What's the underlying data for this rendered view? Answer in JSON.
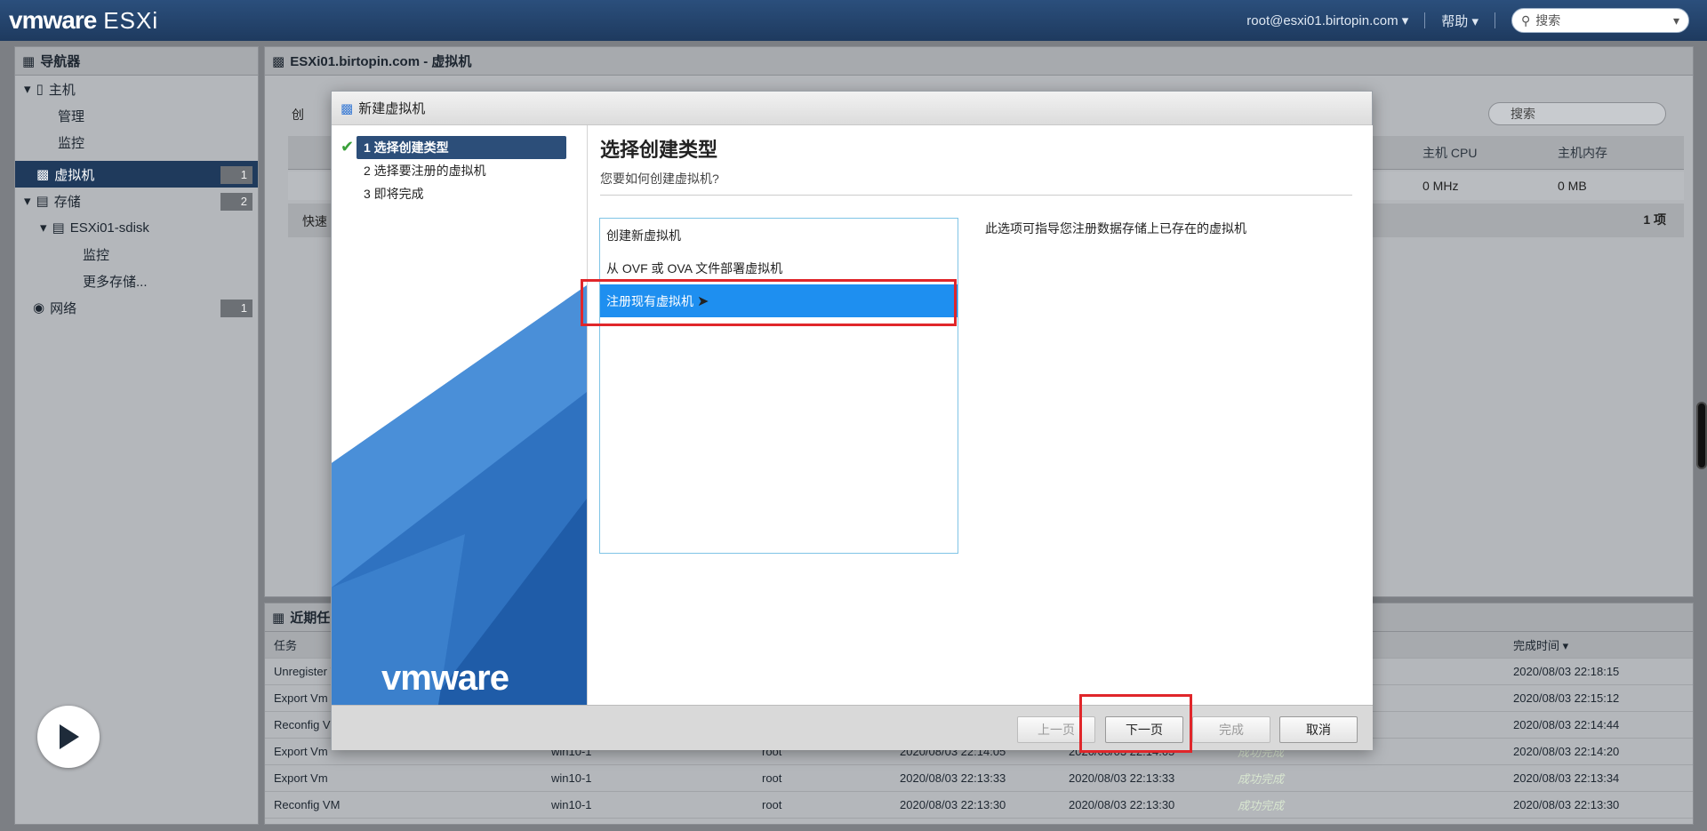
{
  "top": {
    "brand_vm": "vmware",
    "brand_esxi": "ESXi",
    "user": "root@esxi01.birtopin.com",
    "help": "帮助",
    "search_placeholder": "搜索"
  },
  "navigator": {
    "title": "导航器",
    "items": [
      {
        "label": "主机",
        "badge": ""
      },
      {
        "label": "管理",
        "badge": ""
      },
      {
        "label": "监控",
        "badge": ""
      },
      {
        "label": "虚拟机",
        "badge": "1"
      },
      {
        "label": "存储",
        "badge": "2"
      },
      {
        "label": "ESXi01-sdisk",
        "badge": ""
      },
      {
        "label": "监控",
        "badge": ""
      },
      {
        "label": "更多存储...",
        "badge": ""
      },
      {
        "label": "网络",
        "badge": "1"
      }
    ]
  },
  "vmpanel": {
    "title": "ESXi01.birtopin.com - 虚拟机",
    "create_abbr": "创",
    "quick_abbr": "快速",
    "search_placeholder": "搜索",
    "col_cpu": "主机 CPU",
    "col_mem": "主机内存",
    "row_cpu": "0 MHz",
    "row_mem": "0 MB",
    "count": "1 项"
  },
  "tasks": {
    "title": "近期任",
    "col_task": "任务",
    "col_done": "完成时间 ▾",
    "rows": [
      {
        "task": "Unregister V",
        "target": "",
        "user": "",
        "queued": "",
        "start": "",
        "result": "",
        "done": "2020/08/03 22:18:15"
      },
      {
        "task": "Export Vm",
        "target": "",
        "user": "",
        "queued": "",
        "start": "",
        "result": "",
        "done": "2020/08/03 22:15:12"
      },
      {
        "task": "Reconfig VI",
        "target": "",
        "user": "",
        "queued": "",
        "start": "",
        "result": "",
        "done": "2020/08/03 22:14:44"
      },
      {
        "task": "Export Vm",
        "target": "win10-1",
        "user": "root",
        "queued": "2020/08/03 22:14:05",
        "start": "2020/08/03 22:14:05",
        "result": "成功完成",
        "done": "2020/08/03 22:14:20"
      },
      {
        "task": "Export Vm",
        "target": "win10-1",
        "user": "root",
        "queued": "2020/08/03 22:13:33",
        "start": "2020/08/03 22:13:33",
        "result": "成功完成",
        "done": "2020/08/03 22:13:34"
      },
      {
        "task": "Reconfig VM",
        "target": "win10-1",
        "user": "root",
        "queued": "2020/08/03 22:13:30",
        "start": "2020/08/03 22:13:30",
        "result": "成功完成",
        "done": "2020/08/03 22:13:30"
      }
    ]
  },
  "modal": {
    "title": "新建虚拟机",
    "steps": [
      "1 选择创建类型",
      "2 选择要注册的虚拟机",
      "3 即将完成"
    ],
    "logo": "vmware",
    "heading": "选择创建类型",
    "subheading": "您要如何创建虚拟机?",
    "options": [
      "创建新虚拟机",
      "从 OVF 或 OVA 文件部署虚拟机",
      "注册现有虚拟机"
    ],
    "description": "此选项可指导您注册数据存储上已存在的虚拟机",
    "buttons": {
      "back": "上一页",
      "next": "下一页",
      "finish": "完成",
      "cancel": "取消"
    }
  }
}
